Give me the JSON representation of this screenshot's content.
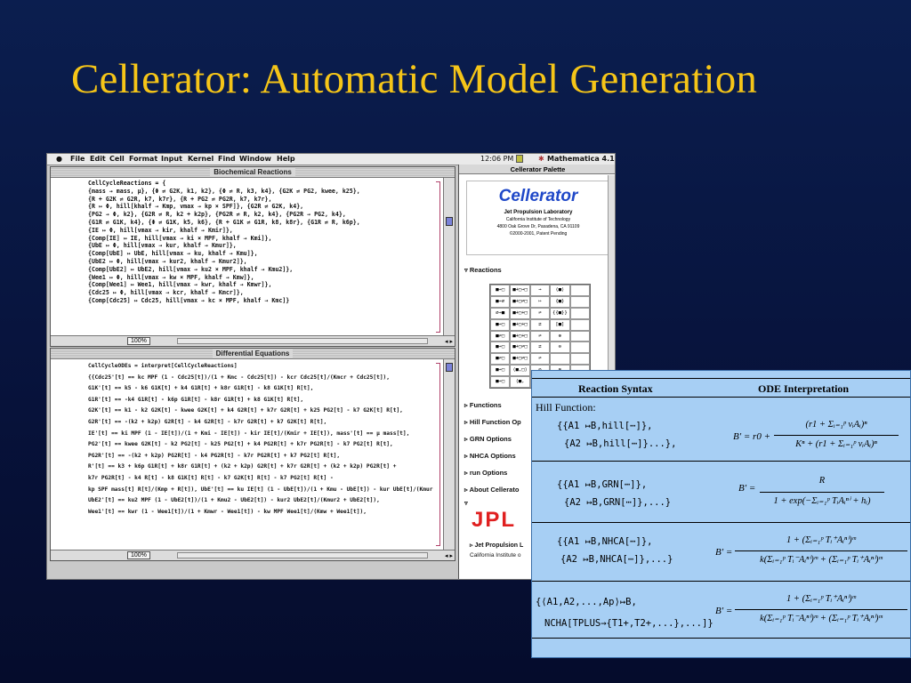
{
  "slide": {
    "title": "Cellerator:  Automatic Model Generation"
  },
  "menubar": {
    "items": [
      "File",
      "Edit",
      "Cell",
      "Format",
      "Input",
      "Kernel",
      "Find",
      "Window",
      "Help"
    ],
    "clock": "12:06 PM",
    "app": "Mathematica 4.1"
  },
  "window1": {
    "title": "Biochemical Reactions",
    "zoom": "100%",
    "lines": [
      "CellCycleReactions = {",
      "{mass → mass, μ}, {Φ ⇌ G2K, k1, k2}, {Φ ⇌ R, k3, k4}, {G2K ⇌ PG2, kwee, k25},",
      "{R + G2K ⇌ G2R, k7, k7r}, {R + PG2 ⇌ PG2R, k7, k7r},",
      "{R ↦ Φ, hill[khalf → Kmp, vmax → kp × SPF]}, {G2R ⇌ G2K, k4},",
      "{PG2 → Φ, k2}, {G2R ⇌ R, k2 + k2p}, {PG2R ⇌ R, k2, k4}, {PG2R → PG2, k4},",
      "{G1R ⇌ G1K, k4}, {Φ ⇌ G1K, k5, k6}, {R + G1K ⇌ G1R, k8, k8r}, {G1R ⇌ R, k6p},",
      "{IE ↦ Φ, hill[vmax → kir, khalf → Kmir]},",
      "{Comp[IE] ↦ IE, hill[vmax → ki × MPF, khalf → Kmi]},",
      "{UbE ↦ Φ, hill[vmax → kur, khalf → Kmur]},",
      "{Comp[UbE] ↦ UbE, hill[vmax → ku, khalf → Kmu]},",
      "{UbE2 ↦ Φ, hill[vmax → kur2, khalf → Kmur2]},",
      "{Comp[UbE2] ↦ UbE2, hill[vmax → ku2 × MPF, khalf → Kmu2]},",
      "{Wee1 ↦ Φ, hill[vmax → kw × MPF, khalf → Kmw]},",
      "{Comp[Wee1] ↦ Wee1, hill[vmax → kwr, khalf → Kmwr]},",
      "{Cdc25 ↦ Φ, hill[vmax → kcr, khalf → Kmcr]},",
      "{Comp[Cdc25] ↦ Cdc25, hill[vmax → kc × MPF, khalf → Kmc]}"
    ]
  },
  "window2": {
    "title": "Differential Equations",
    "zoom": "100%",
    "lines": [
      "CellCycleODEs = interpret[CellCycleReactions]",
      "{{Cdc25'[t] == kc MPF (1 - Cdc25[t])/(1 + Kmc - Cdc25[t]) - kcr Cdc25[t]/(Kmcr + Cdc25[t]),",
      "G1K'[t] == k5 - k6 G1K[t] + k4 G1R[t] + k8r G1R[t] - k8 G1K[t] R[t],",
      "G1R'[t] == -k4 G1R[t] - k6p G1R[t] - k8r G1R[t] + k8 G1K[t] R[t],",
      "G2K'[t] == k1 - k2 G2K[t] - kwee G2K[t] + k4 G2R[t] + k7r G2R[t] + k25 PG2[t] - k7 G2K[t] R[t],",
      "G2R'[t] == -(k2 + k2p) G2R[t] - k4 G2R[t] - k7r G2R[t] + k7 G2K[t] R[t],",
      "IE'[t] == ki MPF (1 - IE[t])/(1 + Kmi - IE[t]) - kir IE[t]/(Kmir + IE[t]), mass'[t] == μ mass[t],",
      "PG2'[t] == kwee G2K[t] - k2 PG2[t] - k25 PG2[t] + k4 PG2R[t] + k7r PG2R[t] - k7 PG2[t] R[t],",
      "PG2R'[t] == -(k2 + k2p) PG2R[t] - k4 PG2R[t] - k7r PG2R[t] + k7 PG2[t] R[t],",
      "R'[t] == k3 + k6p G1R[t] + k8r G1R[t] + (k2 + k2p) G2R[t] + k7r G2R[t] + (k2 + k2p) PG2R[t] +",
      "k7r PG2R[t] - k4 R[t] - k8 G1K[t] R[t] - k7 G2K[t] R[t] - k7 PG2[t] R[t] -",
      "kp SPF mass[t] R[t]/(Kmp + R[t]), UbE'[t] == ku IE[t] (1 - UbE[t])/(1 + Kmu - UbE[t]) - kur UbE[t]/(Kmur + UbE[t]),",
      "UbE2'[t] == ku2 MPF (1 - UbE2[t])/(1 + Kmu2 - UbE2[t]) - kur2 UbE2[t]/(Kmur2 + UbE2[t]),",
      "Wee1'[t] == kwr (1 - Wee1[t])/(1 + Kmwr - Wee1[t]) - kw MPF Wee1[t]/(Kmw + Wee1[t]),"
    ]
  },
  "palette": {
    "title": "Cellerator Palette",
    "name": "Cellerator",
    "lab": "Jet Propulsion Laboratory",
    "inst": "California Institute of Technology",
    "addr": "4800 Oak Grove Dr, Pasadena, CA 91109",
    "copy": "©2000-2001, Patent Pending",
    "sections": [
      "Reactions",
      "Functions",
      "Hill Function Op",
      "GRN Options",
      "NHCA Options",
      "run Options",
      "About Cellerato"
    ],
    "logo": "JPL",
    "foot1": "Jet Propulsion L",
    "foot2": "California Institute o"
  },
  "table": {
    "head_left": "Reaction Syntax",
    "head_right": "ODE Interpretation",
    "hill_label": "Hill Function:",
    "rows": [
      {
        "l1": "{{A1 ↦B,hill[⋯]},",
        "l2": "{A2 ↦B,hill[⋯]}...},"
      },
      {
        "l1": "{{A1 ↦B,GRN[⋯]},",
        "l2": "{A2 ↦B,GRN[⋯]},...}"
      },
      {
        "l1": "{{A1 ↦B,NHCA[⋯]},",
        "l2": "{A2 ↦B,NHCA[⋯]},...}"
      },
      {
        "l1": "{⟨A1,A2,...,Ap⟩↦B,",
        "l2": "NCHA[TPLUS→{T1+,T2+,...},...]}"
      }
    ],
    "f1_left": "B′ = r0 +",
    "f1_num": "(r1 + Σᵢ₌₁ᵖ vᵢAᵢ)ⁿ",
    "f1_den": "Kⁿ + (r1 + Σᵢ₌₁ᵖ vᵢAᵢ)ⁿ",
    "f2_left": "B′ =",
    "f2_num": "R",
    "f2_den": "1 + exp(−Σᵢ₌₁ᵖ TᵢAᵢⁿⁱ + hᵢ)",
    "f3_left": "B′ =",
    "f3_num": "1 + (Σᵢ₌₁ᵖ Tᵢ⁺Aᵢⁿⁱ)ᵐ",
    "f3_den": "k(Σᵢ₌₁ᵖ Tᵢ⁻Aᵢⁿⁱ)ᵐ + (Σᵢ₌₁ᵖ Tᵢ⁺Aᵢⁿⁱ)ᵐ",
    "f4_left": "B′ =",
    "f4_num": "1 + (Σᵢ₌₁ᵖ Tᵢ⁺Aᵢⁿⁱ)ᵐ",
    "f4_den": "k(Σᵢ₌₁ᵖ Tᵢ⁻Aᵢⁿⁱ)ᵐ + (Σᵢ₌₁ᵖ Tᵢ⁺Aᵢⁿⁱ)ᵐ"
  }
}
